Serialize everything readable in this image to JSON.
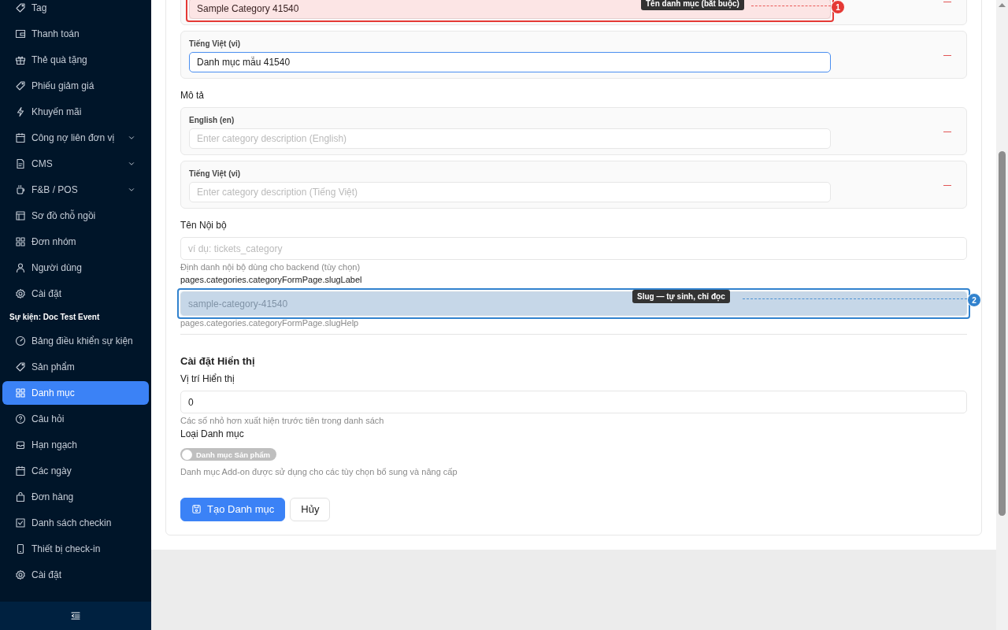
{
  "sidebar": {
    "groups": [
      {
        "items": [
          {
            "label": "Tag",
            "selected": false,
            "kind": "link"
          },
          {
            "label": "Thanh toán",
            "selected": false,
            "kind": "link"
          },
          {
            "label": "Thẻ quà tặng",
            "selected": false,
            "kind": "link"
          },
          {
            "label": "Phiếu giảm giá",
            "selected": false,
            "kind": "link"
          },
          {
            "label": "Khuyến mãi",
            "selected": false,
            "kind": "link"
          },
          {
            "label": "Công nợ liên đơn vị",
            "selected": false,
            "kind": "group"
          },
          {
            "label": "CMS",
            "selected": false,
            "kind": "group"
          },
          {
            "label": "F&B / POS",
            "selected": false,
            "kind": "group"
          },
          {
            "label": "Sơ đồ chỗ ngồi",
            "selected": false,
            "kind": "link"
          },
          {
            "label": "Đơn nhóm",
            "selected": false,
            "kind": "link"
          },
          {
            "label": "Người dùng",
            "selected": false,
            "kind": "link"
          },
          {
            "label": "Cài đặt",
            "selected": false,
            "kind": "link"
          }
        ]
      },
      {
        "title": "Sự kiện: Doc Test Event",
        "items": [
          {
            "label": "Bảng điều khiển sự kiện",
            "selected": false,
            "kind": "link"
          },
          {
            "label": "Sản phẩm",
            "selected": false,
            "kind": "link"
          },
          {
            "label": "Danh mục",
            "selected": true,
            "kind": "link"
          },
          {
            "label": "Câu hỏi",
            "selected": false,
            "kind": "link"
          },
          {
            "label": "Hạn ngạch",
            "selected": false,
            "kind": "link"
          },
          {
            "label": "Các ngày",
            "selected": false,
            "kind": "link"
          },
          {
            "label": "Đơn hàng",
            "selected": false,
            "kind": "link"
          },
          {
            "label": "Danh sách checkin",
            "selected": false,
            "kind": "link"
          },
          {
            "label": "Thiết bị check-in",
            "selected": false,
            "kind": "link"
          },
          {
            "label": "Cài đặt",
            "selected": false,
            "kind": "link"
          }
        ]
      }
    ]
  },
  "form": {
    "name_translations": [
      {
        "value": "Sample Category 41540",
        "focused": false,
        "annotation": {
          "number": "1",
          "label": "Tên danh mục (bắt buộc)",
          "color": "#e53935"
        }
      },
      {
        "label": "Tiếng Việt (vi)",
        "value": "Danh mục mẫu 41540",
        "focused": true
      }
    ],
    "description": {
      "label": "Mô tả",
      "translations": [
        {
          "label": "English (en)",
          "placeholder": "Enter category description (English)",
          "focused": false
        },
        {
          "label": "Tiếng Việt (vi)",
          "placeholder": "Enter category description (Tiếng Việt)",
          "focused": false
        }
      ]
    },
    "internal_name": {
      "label": "Tên Nội bộ",
      "placeholder": "ví dụ: tickets_category",
      "help": "Định danh nội bộ dùng cho backend (tùy chọn)"
    },
    "slug": {
      "label": "pages.categories.categoryFormPage.slugLabel",
      "value": "sample-category-41540",
      "disabled": true,
      "help": "pages.categories.categoryFormPage.slugHelp",
      "annotation": {
        "number": "2",
        "label": "Slug — tự sinh, chỉ đọc",
        "color": "#3182ce"
      }
    },
    "display_settings": {
      "title": "Cài đặt Hiển thị",
      "position": {
        "label": "Vị trí Hiển thị",
        "value": "0",
        "help": "Các số nhỏ hơn xuất hiện trước tiên trong danh sách"
      },
      "type": {
        "label": "Loại Danh mục",
        "switch_label": "Danh mục Sản phẩm",
        "on": false,
        "help": "Danh mục Add-on được sử dụng cho các tùy chọn bổ sung và nâng cấp"
      }
    },
    "buttons": [
      {
        "label": "Tạo Danh mục",
        "kind": "primary"
      },
      {
        "label": "Hủy",
        "kind": "default"
      }
    ]
  }
}
